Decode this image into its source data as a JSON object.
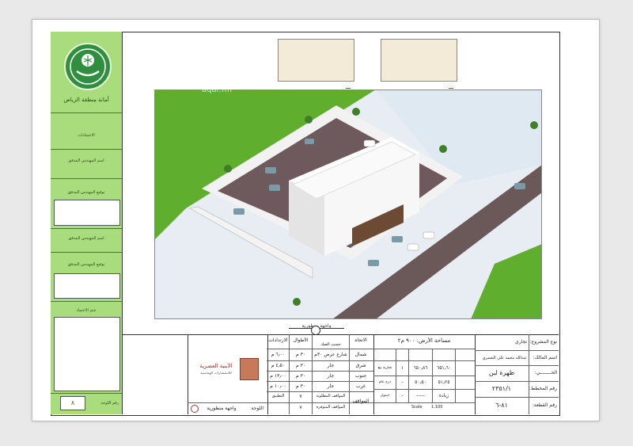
{
  "sidebar": {
    "logo_caption": "أمانة منطقة الرياض",
    "approvals_label": "الاعتمادات",
    "checker_name_label": "اسم المهندس المدقق",
    "checker_sign_label": "توقيع المهندس المدقق",
    "checker2_name_label": "اسم المهندس المدقق",
    "checker2_sign_label": "توقيع المهندس المدقق",
    "approval_stamp_label": "ختم الاعتماد",
    "board_no_label": "رقم اللوحة",
    "board_no_value": "٨"
  },
  "watermark": "aqar.fm",
  "view_title": "واجهة منظورية",
  "site_table": {
    "headers": [
      "الاتجاه",
      "الأطوال",
      "الارتدادات"
    ],
    "header_extra": "حسب الصك",
    "rows": [
      {
        "dir": "شمال",
        "neighbor": "شارع عرض ٣٠م",
        "len": "٣٠ م",
        "setback": "٦٫٠٠ م"
      },
      {
        "dir": "شرق",
        "neighbor": "جار",
        "len": "٣٠ م",
        "setback": "٤٫٥٠ م"
      },
      {
        "dir": "جنوب",
        "neighbor": "جار",
        "len": "٣٠ م",
        "setback": "١٣٫٠٠ م"
      },
      {
        "dir": "غرب",
        "neighbor": "جار",
        "len": "٣٠ م",
        "setback": "١٠٫٠٠ م"
      }
    ],
    "parking_label": "المواقف",
    "parking_rows": [
      {
        "label": "المواقف المطلوبة",
        "value": "٧"
      },
      {
        "label": "المواقف المتوفرة",
        "value": "٧"
      }
    ],
    "extra_col_label": "التطبيق"
  },
  "area_table": {
    "title": "مساحة الأرض: ٩٠٠ م٢",
    "rows": [
      {
        "a": "٦٥١٫٦٠",
        "b": "٦٥٠٫٨٦",
        "c": "١",
        "d": "تجارية بيع"
      },
      {
        "a": "٥١٫٢٥",
        "b": "٥٠٫٥٠",
        "c": "-",
        "d": "درج عام"
      },
      {
        "a": "زيادة",
        "b": "-----",
        "c": "-",
        "d": "أسوار"
      }
    ],
    "scale_label": "Scale",
    "scale_value": "1:100"
  },
  "project_info": {
    "project_type_label": "نوع المشروع:",
    "project_type_value": "تجاري",
    "owner_label": "اسم المالك:",
    "owner_value": "عبدالله محمد علي الشمري",
    "district_label": "الحــــــــي:",
    "district_value": "ظهرة لبن",
    "plan_label": "رقم المخطط:",
    "plan_value": "٢٣٥١/١",
    "plot_label": "رقم القطعة:",
    "plot_value": "٨١-٦"
  },
  "office": {
    "name": "الأبنية العصرية",
    "subtitle": "للاستشارات الهندسية",
    "bottom_label": "اللوحة",
    "bottom_value": "واجهة منظورية"
  }
}
